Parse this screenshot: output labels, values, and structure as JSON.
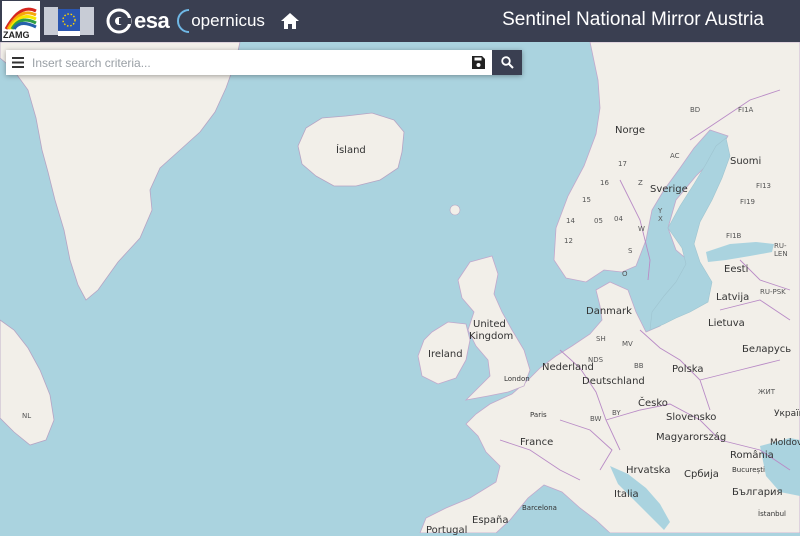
{
  "header": {
    "title": "Sentinel National Mirror Austria",
    "logos": {
      "zamg": "ZAMG",
      "esa": "esa",
      "copernicus": "opernicus"
    },
    "icons": {
      "home": "home-icon"
    }
  },
  "search": {
    "placeholder": "Insert search criteria...",
    "value": "",
    "icons": {
      "menu": "menu-icon",
      "save": "save-icon",
      "search": "search-icon"
    }
  },
  "map": {
    "countries": [
      {
        "name": "Ísland"
      },
      {
        "name": "Ireland"
      },
      {
        "name": "United"
      },
      {
        "name": "Kingdom"
      },
      {
        "name": "Norge"
      },
      {
        "name": "Sverige"
      },
      {
        "name": "Suomi"
      },
      {
        "name": "Eesti"
      },
      {
        "name": "Latvija"
      },
      {
        "name": "Lietuva"
      },
      {
        "name": "Danmark"
      },
      {
        "name": "Nederland"
      },
      {
        "name": "Deutschland"
      },
      {
        "name": "Polska"
      },
      {
        "name": "Беларусь"
      },
      {
        "name": "France"
      },
      {
        "name": "Česko"
      },
      {
        "name": "Slovensko"
      },
      {
        "name": "Magyarország"
      },
      {
        "name": "România"
      },
      {
        "name": "Hrvatska"
      },
      {
        "name": "Србија"
      },
      {
        "name": "България"
      },
      {
        "name": "Italia"
      },
      {
        "name": "España"
      },
      {
        "name": "Portugal"
      },
      {
        "name": "Україна"
      },
      {
        "name": "Moldova"
      }
    ],
    "cities": [
      {
        "name": "London"
      },
      {
        "name": "Paris"
      },
      {
        "name": "Barcelona"
      },
      {
        "name": "București"
      },
      {
        "name": "İstanbul"
      }
    ],
    "regions": [
      {
        "name": "NL"
      },
      {
        "name": "BD"
      },
      {
        "name": "FI1A"
      },
      {
        "name": "AC"
      },
      {
        "name": "FI13"
      },
      {
        "name": "FI19"
      },
      {
        "name": "FI1B"
      },
      {
        "name": "RU-LEN"
      },
      {
        "name": "RU-PSK"
      },
      {
        "name": "17"
      },
      {
        "name": "16"
      },
      {
        "name": "15"
      },
      {
        "name": "14"
      },
      {
        "name": "05"
      },
      {
        "name": "04"
      },
      {
        "name": "12"
      },
      {
        "name": "W"
      },
      {
        "name": "X"
      },
      {
        "name": "Z"
      },
      {
        "name": "Y"
      },
      {
        "name": "S"
      },
      {
        "name": "O"
      },
      {
        "name": "SH"
      },
      {
        "name": "MV"
      },
      {
        "name": "NDS"
      },
      {
        "name": "BB"
      },
      {
        "name": "BW"
      },
      {
        "name": "BY"
      },
      {
        "name": "ЖИТ"
      }
    ]
  }
}
